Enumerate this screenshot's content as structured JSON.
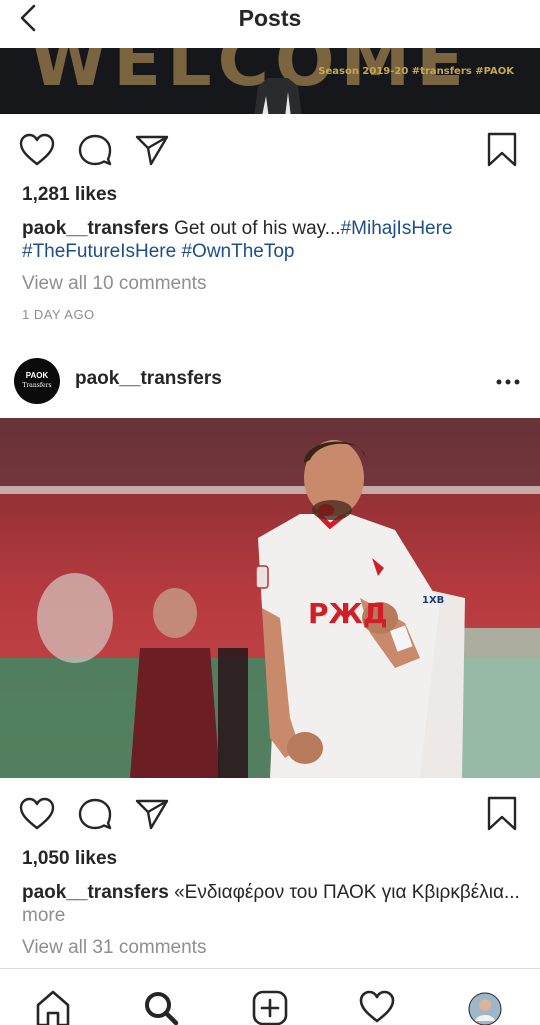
{
  "header": {
    "title": "Posts",
    "back_icon": "chevron-left-icon"
  },
  "top_banner": {
    "big_text": "WELCOME",
    "tag_text": "Season 2019-20 #transfers #PAOK"
  },
  "post1": {
    "likes": "1,281 likes",
    "caption_user": "paok__transfers",
    "caption_text": " Get out of his way...",
    "hashtags": [
      "#MihajIsHere",
      "#TheFutureIsHere",
      "#OwnTheTop"
    ],
    "view_comments": "View all 10 comments",
    "time_ago": "1 DAY AGO"
  },
  "post2": {
    "username": "paok__transfers",
    "avatar_line1": "PAOK",
    "avatar_line2": "Transfers",
    "jersey_sponsor": "РЖД",
    "jersey_sleeve": "1XB",
    "likes": "1,050 likes",
    "caption_user": "paok__transfers",
    "caption_text": " «Ενδιαφέρον του ΠΑΟΚ για Κβιρκβέλια...",
    "caption_more": "more",
    "view_comments": "View all 31 comments"
  },
  "nav": {
    "items": [
      "home-icon",
      "search-icon",
      "add-post-icon",
      "activity-heart-icon",
      "profile-avatar"
    ]
  },
  "colors": {
    "text": "#262626",
    "muted": "#8e8e8e",
    "hashtag": "#1d4e89",
    "divider": "#dbdbdb"
  }
}
